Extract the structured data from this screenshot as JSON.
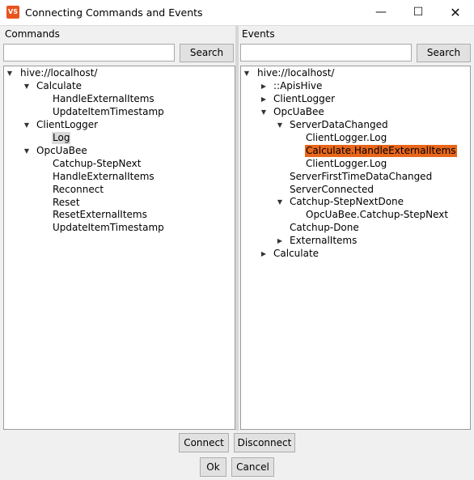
{
  "window": {
    "title": "Connecting Commands and Events",
    "icon_label": "VS",
    "minimize": "—",
    "maximize": "☐",
    "close": "✕"
  },
  "commands": {
    "label": "Commands",
    "search_value": "",
    "search_button": "Search",
    "tree": {
      "root": "hive://localhost/",
      "calculate": "Calculate",
      "calc_handle": "HandleExternalItems",
      "calc_update": "UpdateItemTimestamp",
      "clientlogger": "ClientLogger",
      "log": "Log",
      "opcuabee": "OpcUaBee",
      "opc_catchup": "Catchup-StepNext",
      "opc_handle": "HandleExternalItems",
      "opc_reconnect": "Reconnect",
      "opc_reset": "Reset",
      "opc_reset_ext": "ResetExternalItems",
      "opc_update": "UpdateItemTimestamp"
    }
  },
  "events": {
    "label": "Events",
    "search_value": "",
    "search_button": "Search",
    "tree": {
      "root": "hive://localhost/",
      "apishive": "::ApisHive",
      "clientlogger": "ClientLogger",
      "opcuabee": "OpcUaBee",
      "serverdatachanged": "ServerDataChanged",
      "sdc_log1": "ClientLogger.Log",
      "sdc_calc": "Calculate.HandleExternalItems",
      "sdc_log2": "ClientLogger.Log",
      "server_first": "ServerFirstTimeDataChanged",
      "server_connected": "ServerConnected",
      "catchup_stepnextdone": "Catchup-StepNextDone",
      "csnd_child": "OpcUaBee.Catchup-StepNext",
      "catchup_done": "Catchup-Done",
      "external_items": "ExternalItems",
      "calculate": "Calculate"
    }
  },
  "buttons": {
    "connect": "Connect",
    "disconnect": "Disconnect",
    "ok": "Ok",
    "cancel": "Cancel"
  },
  "colors": {
    "selected_event": "#e8661a",
    "selected_command": "#d9d9d9"
  }
}
